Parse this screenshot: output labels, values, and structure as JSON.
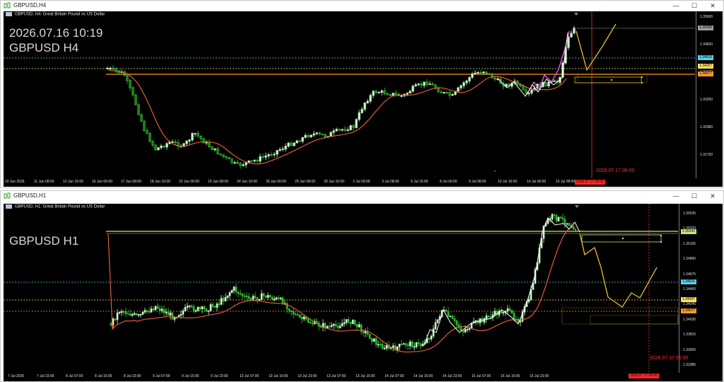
{
  "colors": {
    "background": "#000000",
    "bull_candle": "#ccffcc",
    "bear_candle": "#33cc33",
    "moving_average": "#e05a3c",
    "zigzag_white": "#ffffff",
    "zigzag_magenta": "#ff55ff",
    "forecast": "#e8c020",
    "bid_line": "#c8e878",
    "level_cyan": "#5ad0e6",
    "level_yellow": "#ffe060",
    "level_orange": "#ff9a2a",
    "vline_red": "#ff3030"
  },
  "windows": [
    {
      "title": "GBPUSD,H4",
      "chart_header": "GBPUSD, H4:  Great Britain Pound vs US Dollar",
      "overlay_lines": [
        "2026.07.16 10:19",
        "GBPUSD H4"
      ],
      "price_ticks": [
        "1.35600",
        "1.34820",
        "1.34040",
        "1.33260",
        "1.32480",
        "1.31700"
      ],
      "price_tags": [
        {
          "text": "1.35268",
          "color": "#9e9e9e"
        },
        {
          "text": "1.34616",
          "color": "#5ad0e6"
        },
        {
          "text": "1.34257",
          "color": "#ffe060"
        },
        {
          "text": "1.34077",
          "color": "#ff9a2a"
        }
      ],
      "time_ticks": [
        "10 Jun 2026",
        "11 Jun 08:00",
        "12 Jun 16:00",
        "16 Jun 00:00",
        "17 Jun 08:00",
        "18 Jun 16:00",
        "22 Jun 00:00",
        "23 Jun 08:00",
        "24 Jun 16:00",
        "26 Jun 00:00",
        "29 Jun 08:00",
        "30 Jun 16:00",
        "2 Jul 00:00",
        "3 Jul 08:00",
        "6 Jul 16:00",
        "8 Jul 00:00",
        "9 Jul 08:00",
        "10 Jul 16:00",
        "14 Jul 00:00",
        "15 Jul 08:00"
      ],
      "vline_label": "2026.07.17 06:00",
      "vline_time_tag": "2026.07.17 06:00"
    },
    {
      "title": "GBPUSD,H1",
      "chart_header": "GBPUSD, H1:  Great Britain Pound vs US Dollar",
      "overlay_lines": [
        "GBPUSD H1"
      ],
      "price_ticks": [
        "1.35535",
        "1.35320",
        "1.35105",
        "1.34890",
        "1.34675",
        "1.34460",
        "1.34245",
        "1.34030",
        "1.33815",
        "1.33600",
        "1.33385"
      ],
      "price_tags": [
        {
          "text": "1.35242",
          "color": "#c8e878"
        },
        {
          "text": "1.34616",
          "color": "#5ad0e6"
        },
        {
          "text": "1.34257",
          "color": "#ffe060"
        },
        {
          "text": "1.34077",
          "color": "#ff9a2a"
        }
      ],
      "time_ticks": [
        "7 Jul 2026",
        "7 Jul 23:00",
        "8 Jul 07:00",
        "8 Jul 15:00",
        "8 Jul 23:00",
        "9 Jul 07:00",
        "9 Jul 15:00",
        "9 Jul 23:00",
        "10 Jul 07:00",
        "10 Jul 15:00",
        "10 Jul 23:00",
        "13 Jul 07:00",
        "13 Jul 15:00",
        "14 Jul 07:00",
        "14 Jul 15:00",
        "14 Jul 23:00",
        "15 Jul 07:00",
        "15 Jul 15:00",
        "15 Jul 23:00"
      ],
      "vline_label": "2026.07.17 06:00",
      "vline_time_tag": "2026.07.17 06:00"
    }
  ]
}
